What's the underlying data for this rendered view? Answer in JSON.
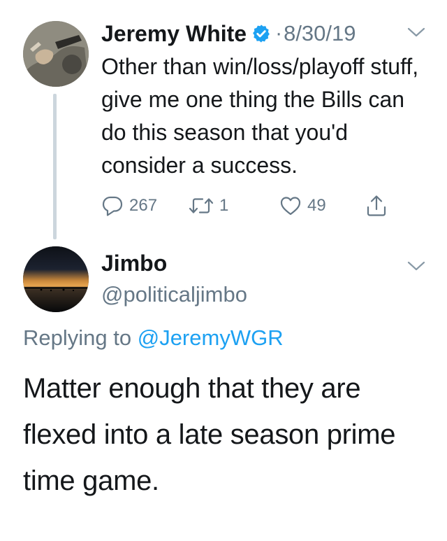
{
  "parent_tweet": {
    "display_name": "Jeremy White",
    "verified": true,
    "separator": "·",
    "date": "8/30/19",
    "text": "Other than win/loss/playoff stuff, give me one thing the Bills can do this season that you'd consider a success.",
    "actions": {
      "reply_count": "267",
      "retweet_count": "1",
      "like_count": "49"
    }
  },
  "reply_tweet": {
    "display_name": "Jimbo",
    "handle": "@politicaljimbo",
    "replying_prefix": "Replying to",
    "replying_handle": "@JeremyWGR",
    "text": "Matter enough that they are flexed into a late season prime time game."
  },
  "colors": {
    "text_primary": "#14171a",
    "text_secondary": "#657786",
    "link": "#1da1f2",
    "verified": "#1da1f2",
    "thread_line": "#ccd6dd"
  },
  "icons": {
    "reply": "reply-icon",
    "retweet": "retweet-icon",
    "like": "heart-icon",
    "share": "share-icon",
    "menu": "chevron-down-icon",
    "verified": "verified-badge-icon"
  }
}
